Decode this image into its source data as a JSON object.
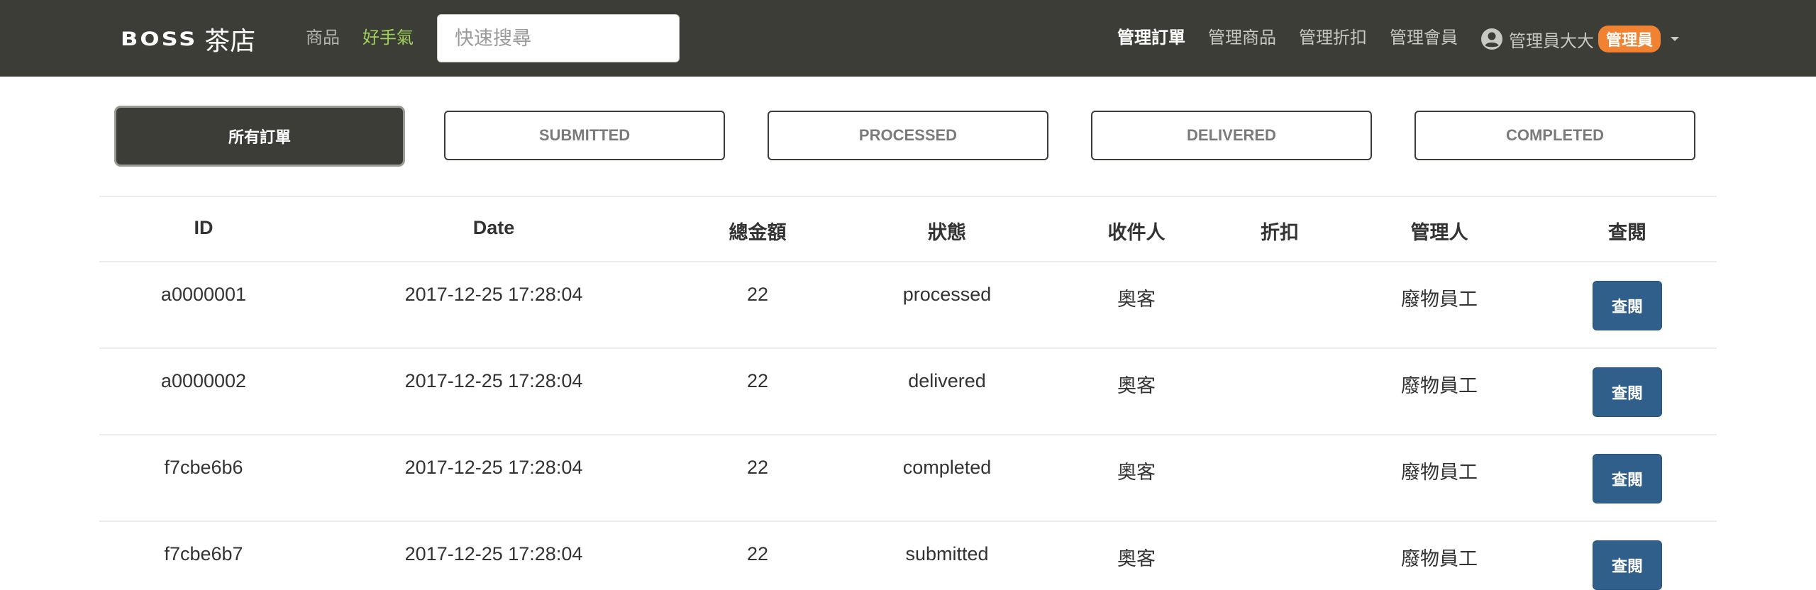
{
  "navbar": {
    "brand_logo": "BOSS",
    "brand_name": "茶店",
    "links": [
      "商品",
      "好手氣"
    ],
    "search_placeholder": "快速搜尋",
    "admin_links": [
      "管理訂單",
      "管理商品",
      "管理折扣",
      "管理會員"
    ],
    "user_name": "管理員大大",
    "role_badge": "管理員",
    "user_icon": "user-circle-icon"
  },
  "tabs": [
    "所有訂單",
    "SUBMITTED",
    "PROCESSED",
    "DELIVERED",
    "COMPLETED"
  ],
  "active_tab": "所有訂單",
  "table": {
    "columns": [
      "ID",
      "Date",
      "總金額",
      "狀態",
      "收件人",
      "折扣",
      "管理人",
      "查閱"
    ],
    "view_label": "查閱",
    "rows": [
      {
        "id": "a0000001",
        "date": "2017-12-25 17:28:04",
        "total": "22",
        "status": "processed",
        "recipient": "奧客",
        "discount": "",
        "manager": "廢物員工"
      },
      {
        "id": "a0000002",
        "date": "2017-12-25 17:28:04",
        "total": "22",
        "status": "delivered",
        "recipient": "奧客",
        "discount": "",
        "manager": "廢物員工"
      },
      {
        "id": "f7cbe6b6",
        "date": "2017-12-25 17:28:04",
        "total": "22",
        "status": "completed",
        "recipient": "奧客",
        "discount": "",
        "manager": "廢物員工"
      },
      {
        "id": "f7cbe6b7",
        "date": "2017-12-25 17:28:04",
        "total": "22",
        "status": "submitted",
        "recipient": "奧客",
        "discount": "",
        "manager": "廢物員工"
      }
    ]
  },
  "colors": {
    "navbar_bg": "#3d3d37",
    "accent_link": "#9fd25a",
    "badge_bg": "#f08232",
    "button_bg": "#2f5f8a"
  }
}
